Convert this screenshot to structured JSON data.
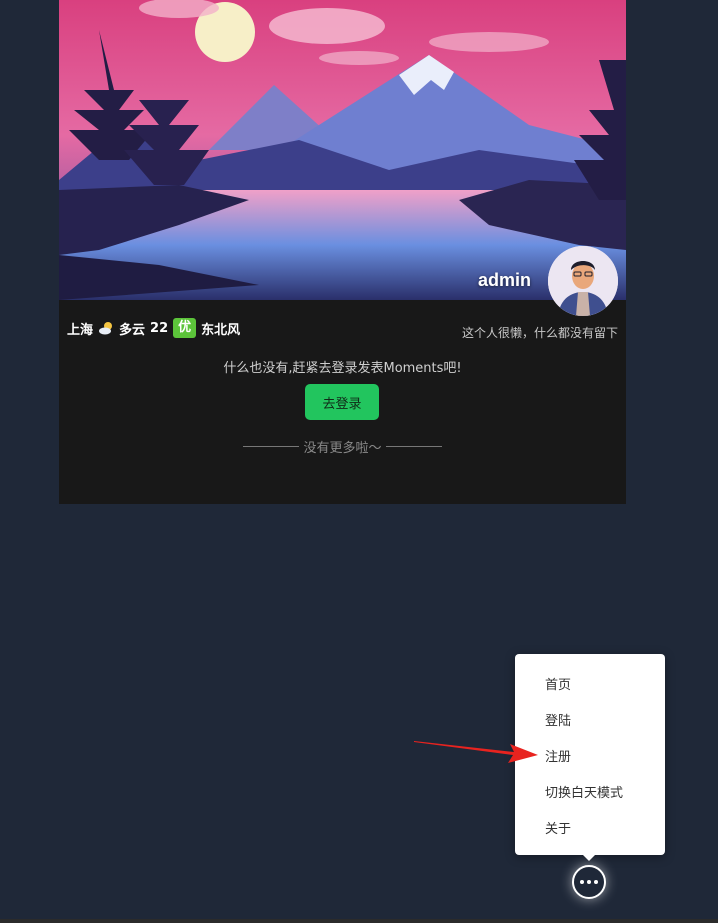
{
  "profile": {
    "username": "admin",
    "signature": "这个人很懒，什么都没有留下"
  },
  "weather": {
    "city": "上海",
    "icon": "partly-cloudy-icon",
    "condition": "多云",
    "temperature": "22",
    "air_quality": "优",
    "wind": "东北风"
  },
  "feed": {
    "empty_message": "什么也没有,赶紧去登录发表Moments吧!",
    "login_button": "去登录",
    "no_more_text": "没有更多啦～"
  },
  "menu": {
    "items": [
      "首页",
      "登陆",
      "注册",
      "切换白天模式",
      "关于"
    ]
  },
  "colors": {
    "page_bg": "#1f2838",
    "card_bg": "#181818",
    "accent_green": "#22c55e",
    "aqi_green": "#5cc43a",
    "annotation_red": "#e8231f"
  }
}
